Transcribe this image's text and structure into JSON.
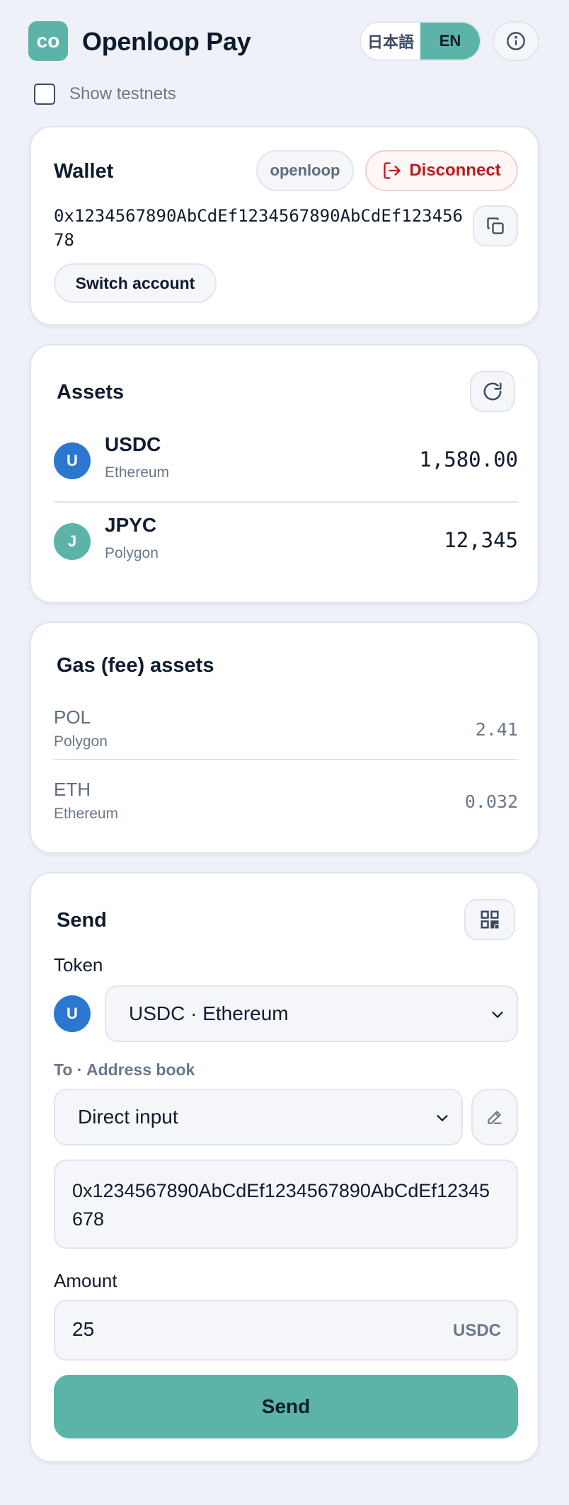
{
  "header": {
    "logo_text": "co",
    "title": "Openloop Pay",
    "lang_ja": "日本語",
    "lang_en": "EN"
  },
  "testnets": {
    "label": "Show testnets",
    "checked": false
  },
  "wallet": {
    "title": "Wallet",
    "provider": "openloop",
    "disconnect_label": "Disconnect",
    "address": "0x1234567890AbCdEf1234567890AbCdEf12345678",
    "switch_label": "Switch account"
  },
  "assets": {
    "title": "Assets",
    "items": [
      {
        "icon": "U",
        "symbol": "USDC",
        "chain": "Ethereum",
        "balance": "1,580.00",
        "color": "#2b77d0"
      },
      {
        "icon": "J",
        "symbol": "JPYC",
        "chain": "Polygon",
        "balance": "12,345",
        "color": "#5cb3a8"
      }
    ]
  },
  "gas": {
    "title": "Gas (fee) assets",
    "items": [
      {
        "symbol": "POL",
        "chain": "Polygon",
        "balance": "2.41"
      },
      {
        "symbol": "ETH",
        "chain": "Ethereum",
        "balance": "0.032"
      }
    ]
  },
  "send": {
    "title": "Send",
    "token_label": "Token",
    "token_icon": "U",
    "token_value": "USDC · Ethereum",
    "to_label": "To · Address book",
    "to_value": "Direct input",
    "address_value": "0x1234567890AbCdEf1234567890AbCdEf12345678",
    "amount_label": "Amount",
    "amount_value": "25",
    "amount_unit": "USDC",
    "button_label": "Send"
  },
  "colors": {
    "accent": "#5cb3a8",
    "danger": "#b91c1c",
    "usdc": "#2b77d0"
  }
}
